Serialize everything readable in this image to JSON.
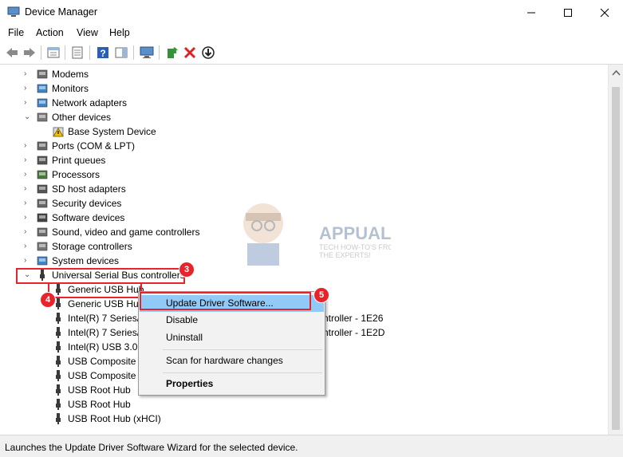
{
  "window": {
    "title": "Device Manager",
    "controls": {
      "minimize": "—",
      "maximize": "☐",
      "close": "✕"
    }
  },
  "menubar": [
    "File",
    "Action",
    "View",
    "Help"
  ],
  "toolbar": [
    "back-icon",
    "forward-icon",
    "properties-icon",
    "driver-details-icon",
    "help-icon",
    "action-pane-icon",
    "monitor-icon",
    "update-driver-icon",
    "uninstall-icon",
    "scan-icon"
  ],
  "tree": [
    {
      "label": "Modems",
      "icon": "modem-icon",
      "expander": "›"
    },
    {
      "label": "Monitors",
      "icon": "monitor-icon",
      "expander": "›"
    },
    {
      "label": "Network adapters",
      "icon": "network-icon",
      "expander": "›"
    },
    {
      "label": "Other devices",
      "icon": "other-devices-icon",
      "expander": "⌄"
    },
    {
      "label": "Base System Device",
      "icon": "warning-device-icon",
      "expander": ""
    },
    {
      "label": "Ports (COM & LPT)",
      "icon": "port-icon",
      "expander": "›"
    },
    {
      "label": "Print queues",
      "icon": "printer-icon",
      "expander": "›"
    },
    {
      "label": "Processors",
      "icon": "processor-icon",
      "expander": "›"
    },
    {
      "label": "SD host adapters",
      "icon": "sd-icon",
      "expander": "›"
    },
    {
      "label": "Security devices",
      "icon": "security-icon",
      "expander": "›"
    },
    {
      "label": "Software devices",
      "icon": "software-icon",
      "expander": "›"
    },
    {
      "label": "Sound, video and game controllers",
      "icon": "sound-icon",
      "expander": "›"
    },
    {
      "label": "Storage controllers",
      "icon": "storage-icon",
      "expander": "›"
    },
    {
      "label": "System devices",
      "icon": "system-icon",
      "expander": "›"
    },
    {
      "label": "Universal Serial Bus controllers",
      "icon": "usb-icon",
      "expander": "⌄"
    },
    {
      "label": "Generic USB Hub",
      "icon": "usb-icon",
      "expander": ""
    },
    {
      "label": "Generic USB Hub",
      "icon": "usb-icon",
      "expander": ""
    },
    {
      "label": "Intel(R) 7 Series/C",
      "icon": "usb-icon",
      "expander": ""
    },
    {
      "label": "Intel(R) 7 Series/C",
      "icon": "usb-icon",
      "expander": ""
    },
    {
      "label": "Intel(R) USB 3.0 e",
      "icon": "usb-icon",
      "expander": ""
    },
    {
      "label": "USB Composite D",
      "icon": "usb-icon",
      "expander": ""
    },
    {
      "label": "USB Composite D",
      "icon": "usb-icon",
      "expander": ""
    },
    {
      "label": "USB Root Hub",
      "icon": "usb-icon",
      "expander": ""
    },
    {
      "label": "USB Root Hub",
      "icon": "usb-icon",
      "expander": ""
    },
    {
      "label": "USB Root Hub (xHCI)",
      "icon": "usb-icon",
      "expander": ""
    }
  ],
  "tree_tails": [
    "ntroller - 1E26",
    "ntroller - 1E2D"
  ],
  "context_menu": {
    "items": [
      "Update Driver Software...",
      "Disable",
      "Uninstall",
      "Scan for hardware changes",
      "Properties"
    ]
  },
  "annotations": {
    "badge3": "3",
    "badge4": "4",
    "badge5": "5"
  },
  "watermark": {
    "brand": "APPUALS",
    "tagline1": "TECH HOW-TO'S FROM",
    "tagline2": "THE EXPERTS!"
  },
  "statusbar": {
    "text": "Launches the Update Driver Software Wizard for the selected device."
  },
  "colors": {
    "accent_red": "#e8232a",
    "selection": "#cce8ff",
    "ctx_highlight": "#91c9f7"
  }
}
